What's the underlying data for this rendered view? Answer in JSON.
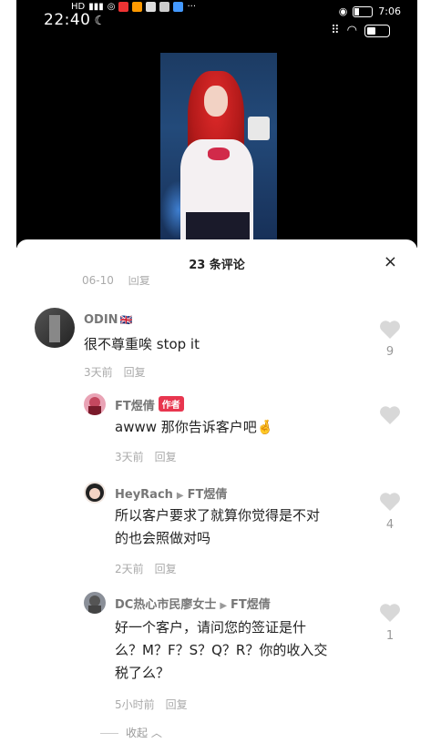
{
  "status_bar": {
    "time_top": "7:06",
    "time_main": "22:40"
  },
  "sheet": {
    "title": "23 条评论",
    "close_label": "×"
  },
  "cut_row": {
    "time": "06-10",
    "reply": "回复"
  },
  "comments": [
    {
      "name": "ODIN",
      "flag": "🇬🇧",
      "text": "很不尊重唉 stop it",
      "time": "3天前",
      "reply": "回复",
      "likes": "9"
    },
    {
      "name": "FT煜倩",
      "tag": "作者",
      "text": "awww 那你告诉客户吧",
      "emoji": "🤞",
      "time": "3天前",
      "reply": "回复",
      "likes": ""
    },
    {
      "name": "HeyRach",
      "reply_to": "FT煜倩",
      "text_l1": "所以客户要求了就算你觉得是不对",
      "text_l2": "的也会照做对吗",
      "time": "2天前",
      "reply": "回复",
      "likes": "4"
    },
    {
      "name": "DC热心市民廖女士",
      "reply_to": "FT煜倩",
      "text_l1": "好一个客户，请问您的签证是什",
      "text_l2": "么？M？F？S？Q？R？你的收入交",
      "text_l3": "税了么？",
      "time": "5小时前",
      "reply": "回复",
      "likes": "1"
    }
  ],
  "collapse_label": "收起",
  "colors": {
    "author_tag": "#e8364f",
    "heart": "#d8d8d8"
  }
}
